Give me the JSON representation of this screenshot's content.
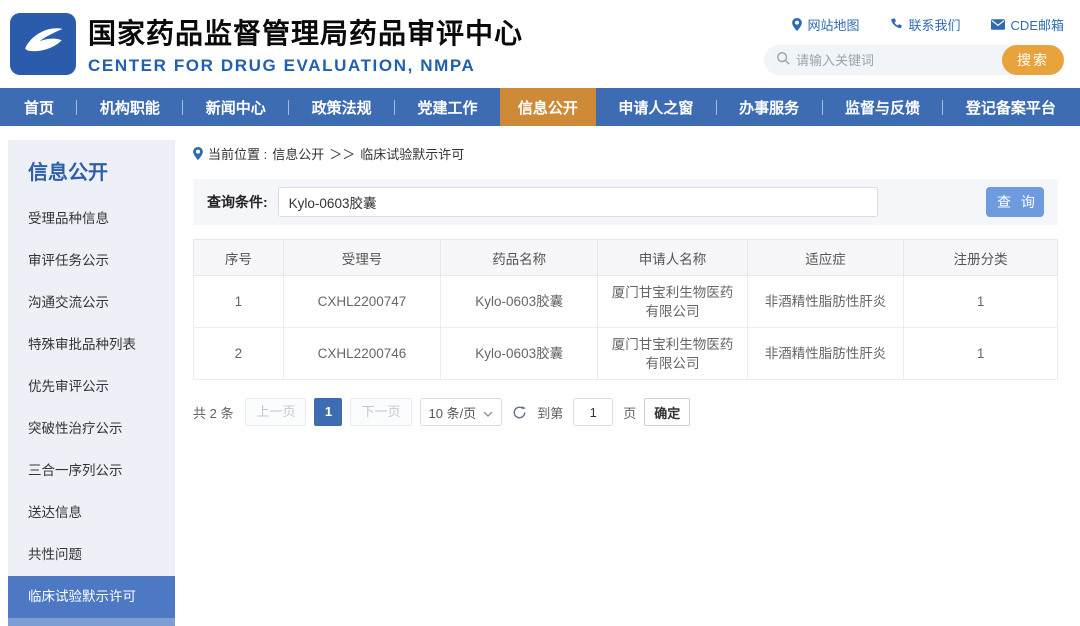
{
  "colors": {
    "nav_blue": "#3d6cb3",
    "nav_active_orange": "#cf8a38",
    "search_button_orange": "#e9a33c",
    "link_blue": "#2f6bb3",
    "sidebar_active_blue": "#4d79c4",
    "query_button_blue": "#6d9bdd",
    "logo_blue": "#2a5cab"
  },
  "header": {
    "title": "国家药品监督管理局药品审评中心",
    "subtitle": "CENTER FOR DRUG EVALUATION, NMPA",
    "links": [
      {
        "icon": "location-icon",
        "label": "网站地图"
      },
      {
        "icon": "phone-icon",
        "label": "联系我们"
      },
      {
        "icon": "mail-icon",
        "label": "CDE邮箱"
      }
    ],
    "search": {
      "placeholder": "请输入关键词",
      "button": "搜索"
    }
  },
  "nav": {
    "items": [
      {
        "label": "首页",
        "active": false
      },
      {
        "label": "机构职能",
        "active": false
      },
      {
        "label": "新闻中心",
        "active": false
      },
      {
        "label": "政策法规",
        "active": false
      },
      {
        "label": "党建工作",
        "active": false
      },
      {
        "label": "信息公开",
        "active": true
      },
      {
        "label": "申请人之窗",
        "active": false
      },
      {
        "label": "办事服务",
        "active": false
      },
      {
        "label": "监督与反馈",
        "active": false
      },
      {
        "label": "登记备案平台",
        "active": false
      }
    ]
  },
  "sidebar": {
    "title": "信息公开",
    "items": [
      {
        "label": "受理品种信息",
        "active": false
      },
      {
        "label": "审评任务公示",
        "active": false
      },
      {
        "label": "沟通交流公示",
        "active": false
      },
      {
        "label": "特殊审批品种列表",
        "active": false
      },
      {
        "label": "优先审评公示",
        "active": false
      },
      {
        "label": "突破性治疗公示",
        "active": false
      },
      {
        "label": "三合一序列公示",
        "active": false
      },
      {
        "label": "送达信息",
        "active": false
      },
      {
        "label": "共性问题",
        "active": false
      },
      {
        "label": "临床试验默示许可",
        "active": true
      }
    ]
  },
  "main": {
    "breadcrumb": {
      "prefix": "当前位置 :",
      "section": "信息公开",
      "separator": "＞＞",
      "current": "临床试验默示许可"
    },
    "query": {
      "label": "查询条件:",
      "value": "Kylo-0603胶囊",
      "button": "查 询"
    },
    "table": {
      "headers": [
        "序号",
        "受理号",
        "药品名称",
        "申请人名称",
        "适应症",
        "注册分类"
      ],
      "rows": [
        [
          "1",
          "CXHL2200747",
          "Kylo-0603胶囊",
          "厦门甘宝利生物医药有限公司",
          "非酒精性脂肪性肝炎",
          "1"
        ],
        [
          "2",
          "CXHL2200746",
          "Kylo-0603胶囊",
          "厦门甘宝利生物医药有限公司",
          "非酒精性脂肪性肝炎",
          "1"
        ]
      ]
    },
    "pagination": {
      "total": "共 2 条",
      "prev": "上一页",
      "page": "1",
      "next": "下一页",
      "page_size": "10 条/页",
      "goto_label": "到第",
      "goto_value": "1",
      "goto_unit": "页",
      "confirm": "确定"
    }
  }
}
